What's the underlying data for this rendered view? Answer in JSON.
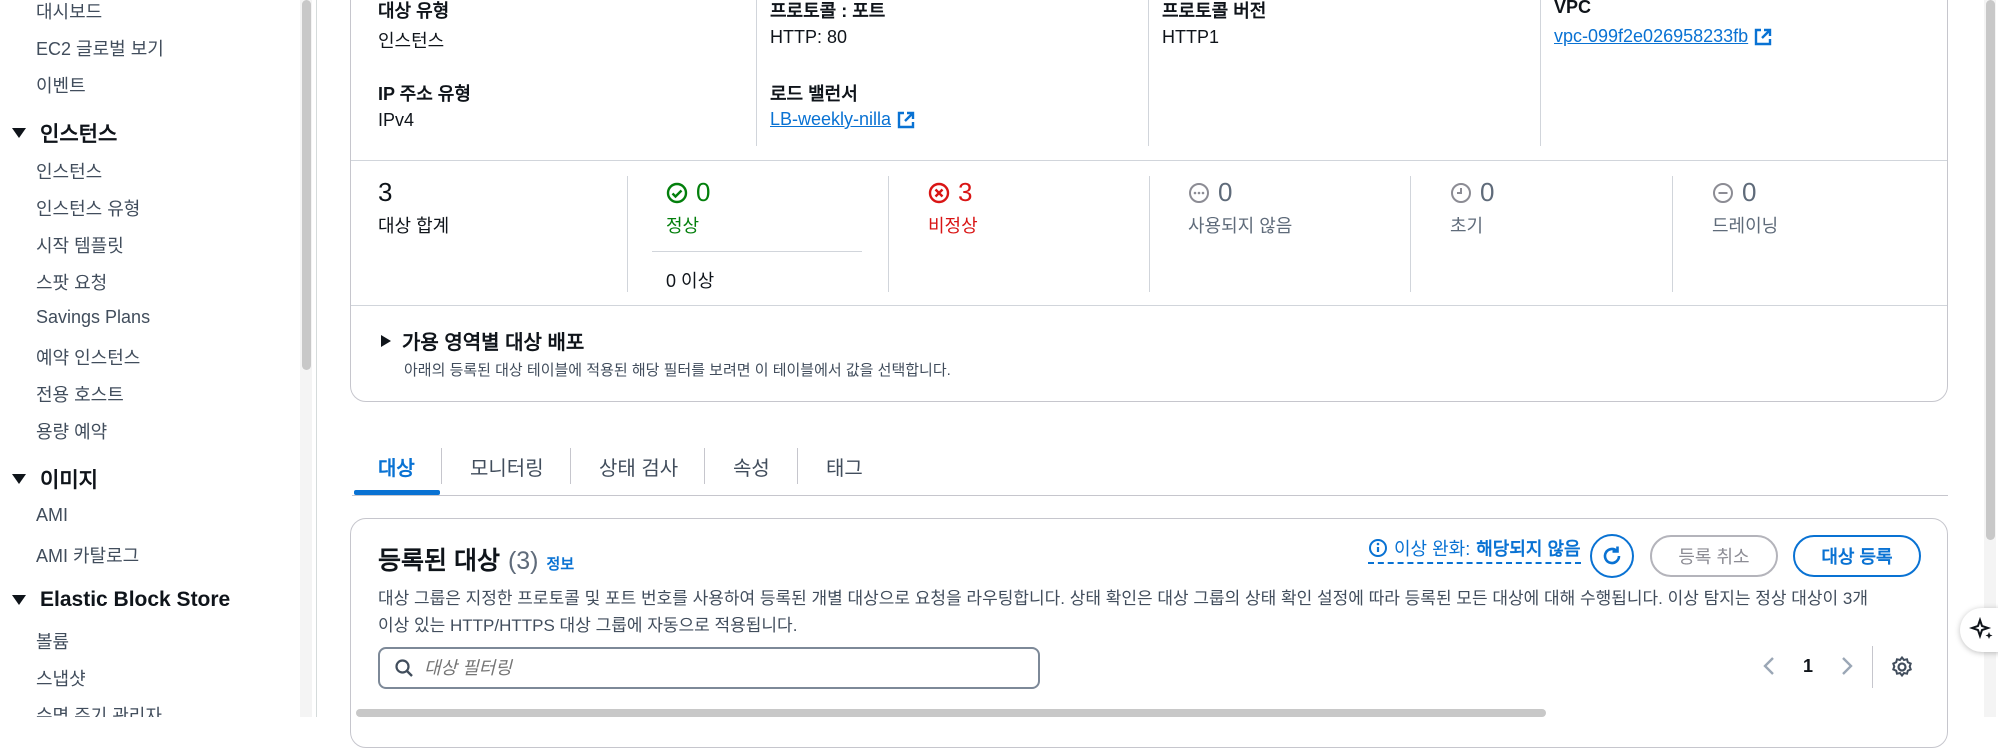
{
  "sidebar": {
    "items_top": [
      {
        "label": "대시보드"
      },
      {
        "label": "EC2 글로벌 보기"
      },
      {
        "label": "이벤트"
      }
    ],
    "sections": [
      {
        "title": "인스턴스",
        "items": [
          "인스턴스",
          "인스턴스 유형",
          "시작 템플릿",
          "스팟 요청",
          "Savings Plans",
          "예약 인스턴스",
          "전용 호스트",
          "용량 예약"
        ]
      },
      {
        "title": "이미지",
        "items": [
          "AMI",
          "AMI 카탈로그"
        ]
      },
      {
        "title": "Elastic Block Store",
        "items": [
          "볼륨",
          "스냅샷",
          "수명 주기 관리자"
        ]
      }
    ]
  },
  "details": {
    "target_type_label": "대상 유형",
    "target_type_value": "인스턴스",
    "protocol_port_label": "프로토콜 : 포트",
    "protocol_port_value": "HTTP: 80",
    "protocol_version_label": "프로토콜 버전",
    "protocol_version_value": "HTTP1",
    "vpc_label": "VPC",
    "vpc_value": "vpc-099f2e026958233fb",
    "ip_type_label": "IP 주소 유형",
    "ip_type_value": "IPv4",
    "lb_label": "로드 밸런서",
    "lb_value": "LB-weekly-nilla"
  },
  "stats": {
    "total_value": "3",
    "total_label": "대상 합계",
    "healthy_value": "0",
    "healthy_label": "정상",
    "healthy_sub": "0 이상",
    "unhealthy_value": "3",
    "unhealthy_label": "비정상",
    "unused_value": "0",
    "unused_label": "사용되지 않음",
    "initial_value": "0",
    "initial_label": "초기",
    "draining_value": "0",
    "draining_label": "드레이닝"
  },
  "az": {
    "title": "가용 영역별 대상 배포",
    "desc": "아래의 등록된 대상 테이블에 적용된 해당 필터를 보려면 이 테이블에서 값을 선택합니다."
  },
  "tabs": [
    "대상",
    "모니터링",
    "상태 검사",
    "속성",
    "태그"
  ],
  "registered": {
    "title": "등록된 대상",
    "count": "(3)",
    "info": "정보",
    "anomaly_prefix": "이상 완화:",
    "anomaly_value": "해당되지 않음",
    "deregister": "등록 취소",
    "register": "대상 등록",
    "desc_line1": "대상 그룹은 지정한 프로토콜 및 포트 번호를 사용하여 등록된 개별 대상으로 요청을 라우팅합니다. 상태 확인은 대상 그룹의 상태 확인 설정에 따라 등록된 모든 대상에 대해 수행됩니다. 이상 탐지는 정상 대상이 3개",
    "desc_line2": "이상 있는 HTTP/HTTPS 대상 그룹에 자동으로 적용됩니다.",
    "search_placeholder": "대상 필터링",
    "page": "1"
  },
  "colors": {
    "accent": "#0972d3",
    "healthy": "#037f0c",
    "unhealthy": "#d91515",
    "muted": "#5f6b7a"
  }
}
